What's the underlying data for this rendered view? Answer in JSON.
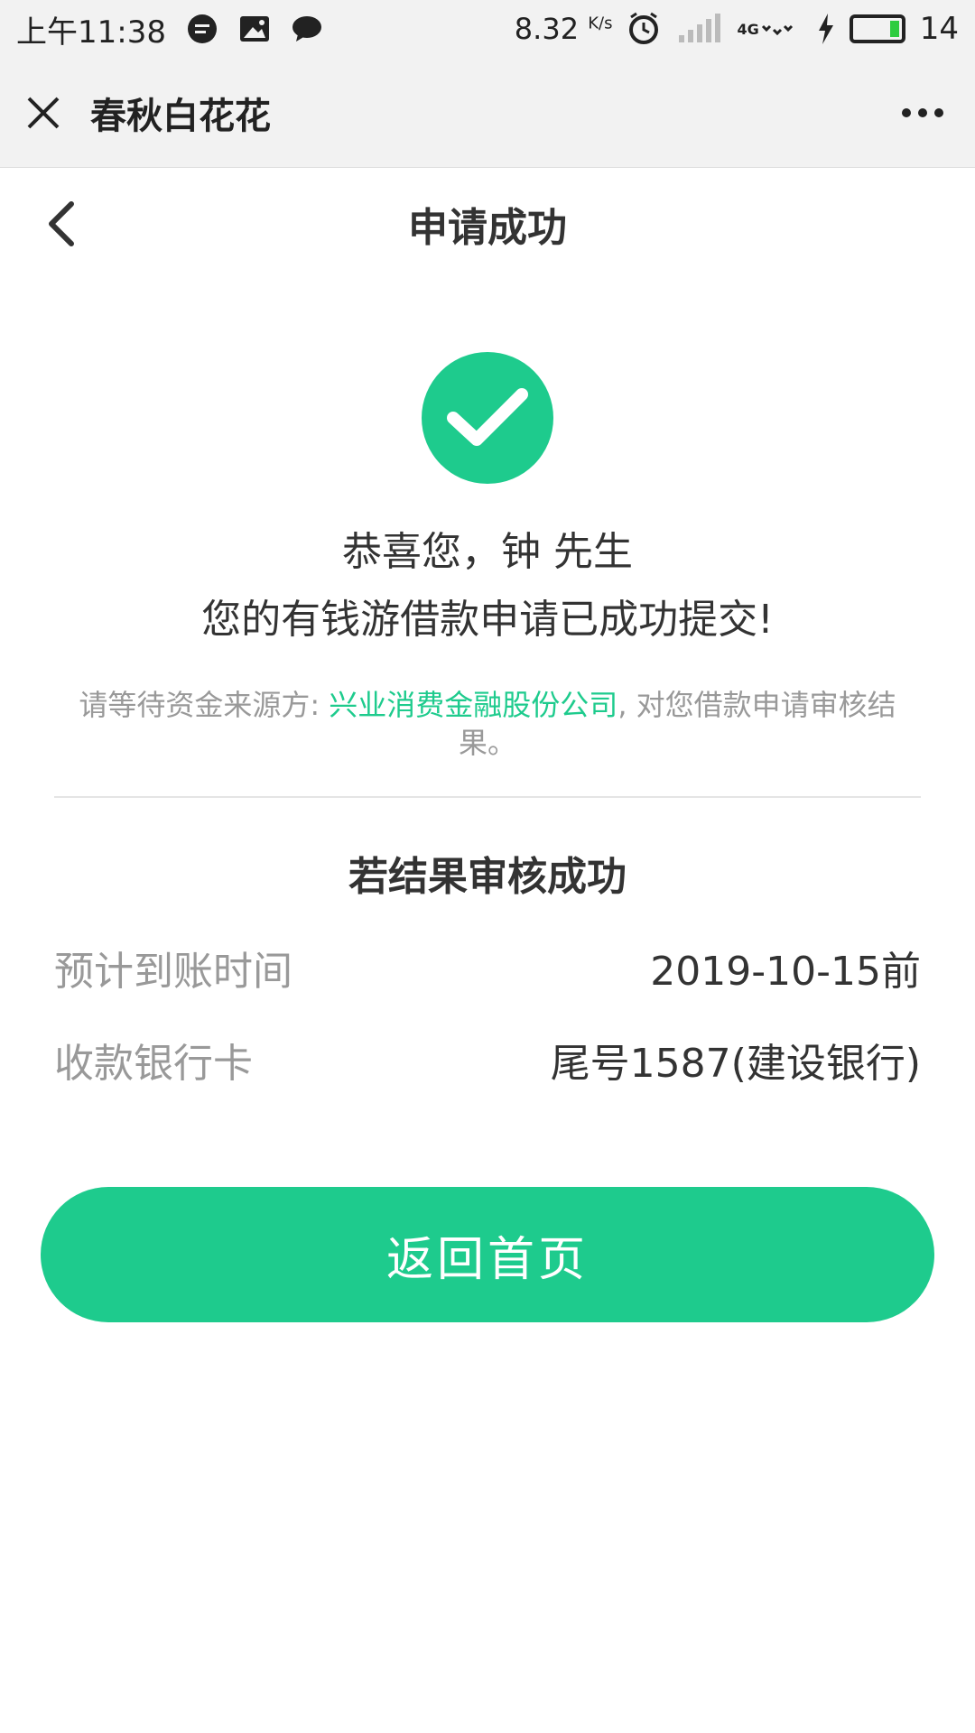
{
  "status_bar": {
    "time": "上午11:38",
    "speed": "8.32",
    "speed_unit": "K/s",
    "battery": "14",
    "network": "4G"
  },
  "app_header": {
    "title": "春秋白花花"
  },
  "nav": {
    "title": "申请成功"
  },
  "result": {
    "greeting": "恭喜您，钟 先生",
    "message": "您的有钱游借款申请已成功提交!",
    "note_prefix": "请等待资金来源方: ",
    "note_company": "兴业消费金融股份公司",
    "note_suffix": ", 对您借款申请审核结果。"
  },
  "details": {
    "section_title": "若结果审核成功",
    "rows": [
      {
        "label": "预计到账时间",
        "value": "2019-10-15前"
      },
      {
        "label": "收款银行卡",
        "value": "尾号1587(建设银行)"
      }
    ]
  },
  "actions": {
    "home_label": "返回首页"
  },
  "colors": {
    "accent": "#1ecb8d",
    "muted_text": "#999999",
    "header_bg": "#f2f2f2"
  }
}
